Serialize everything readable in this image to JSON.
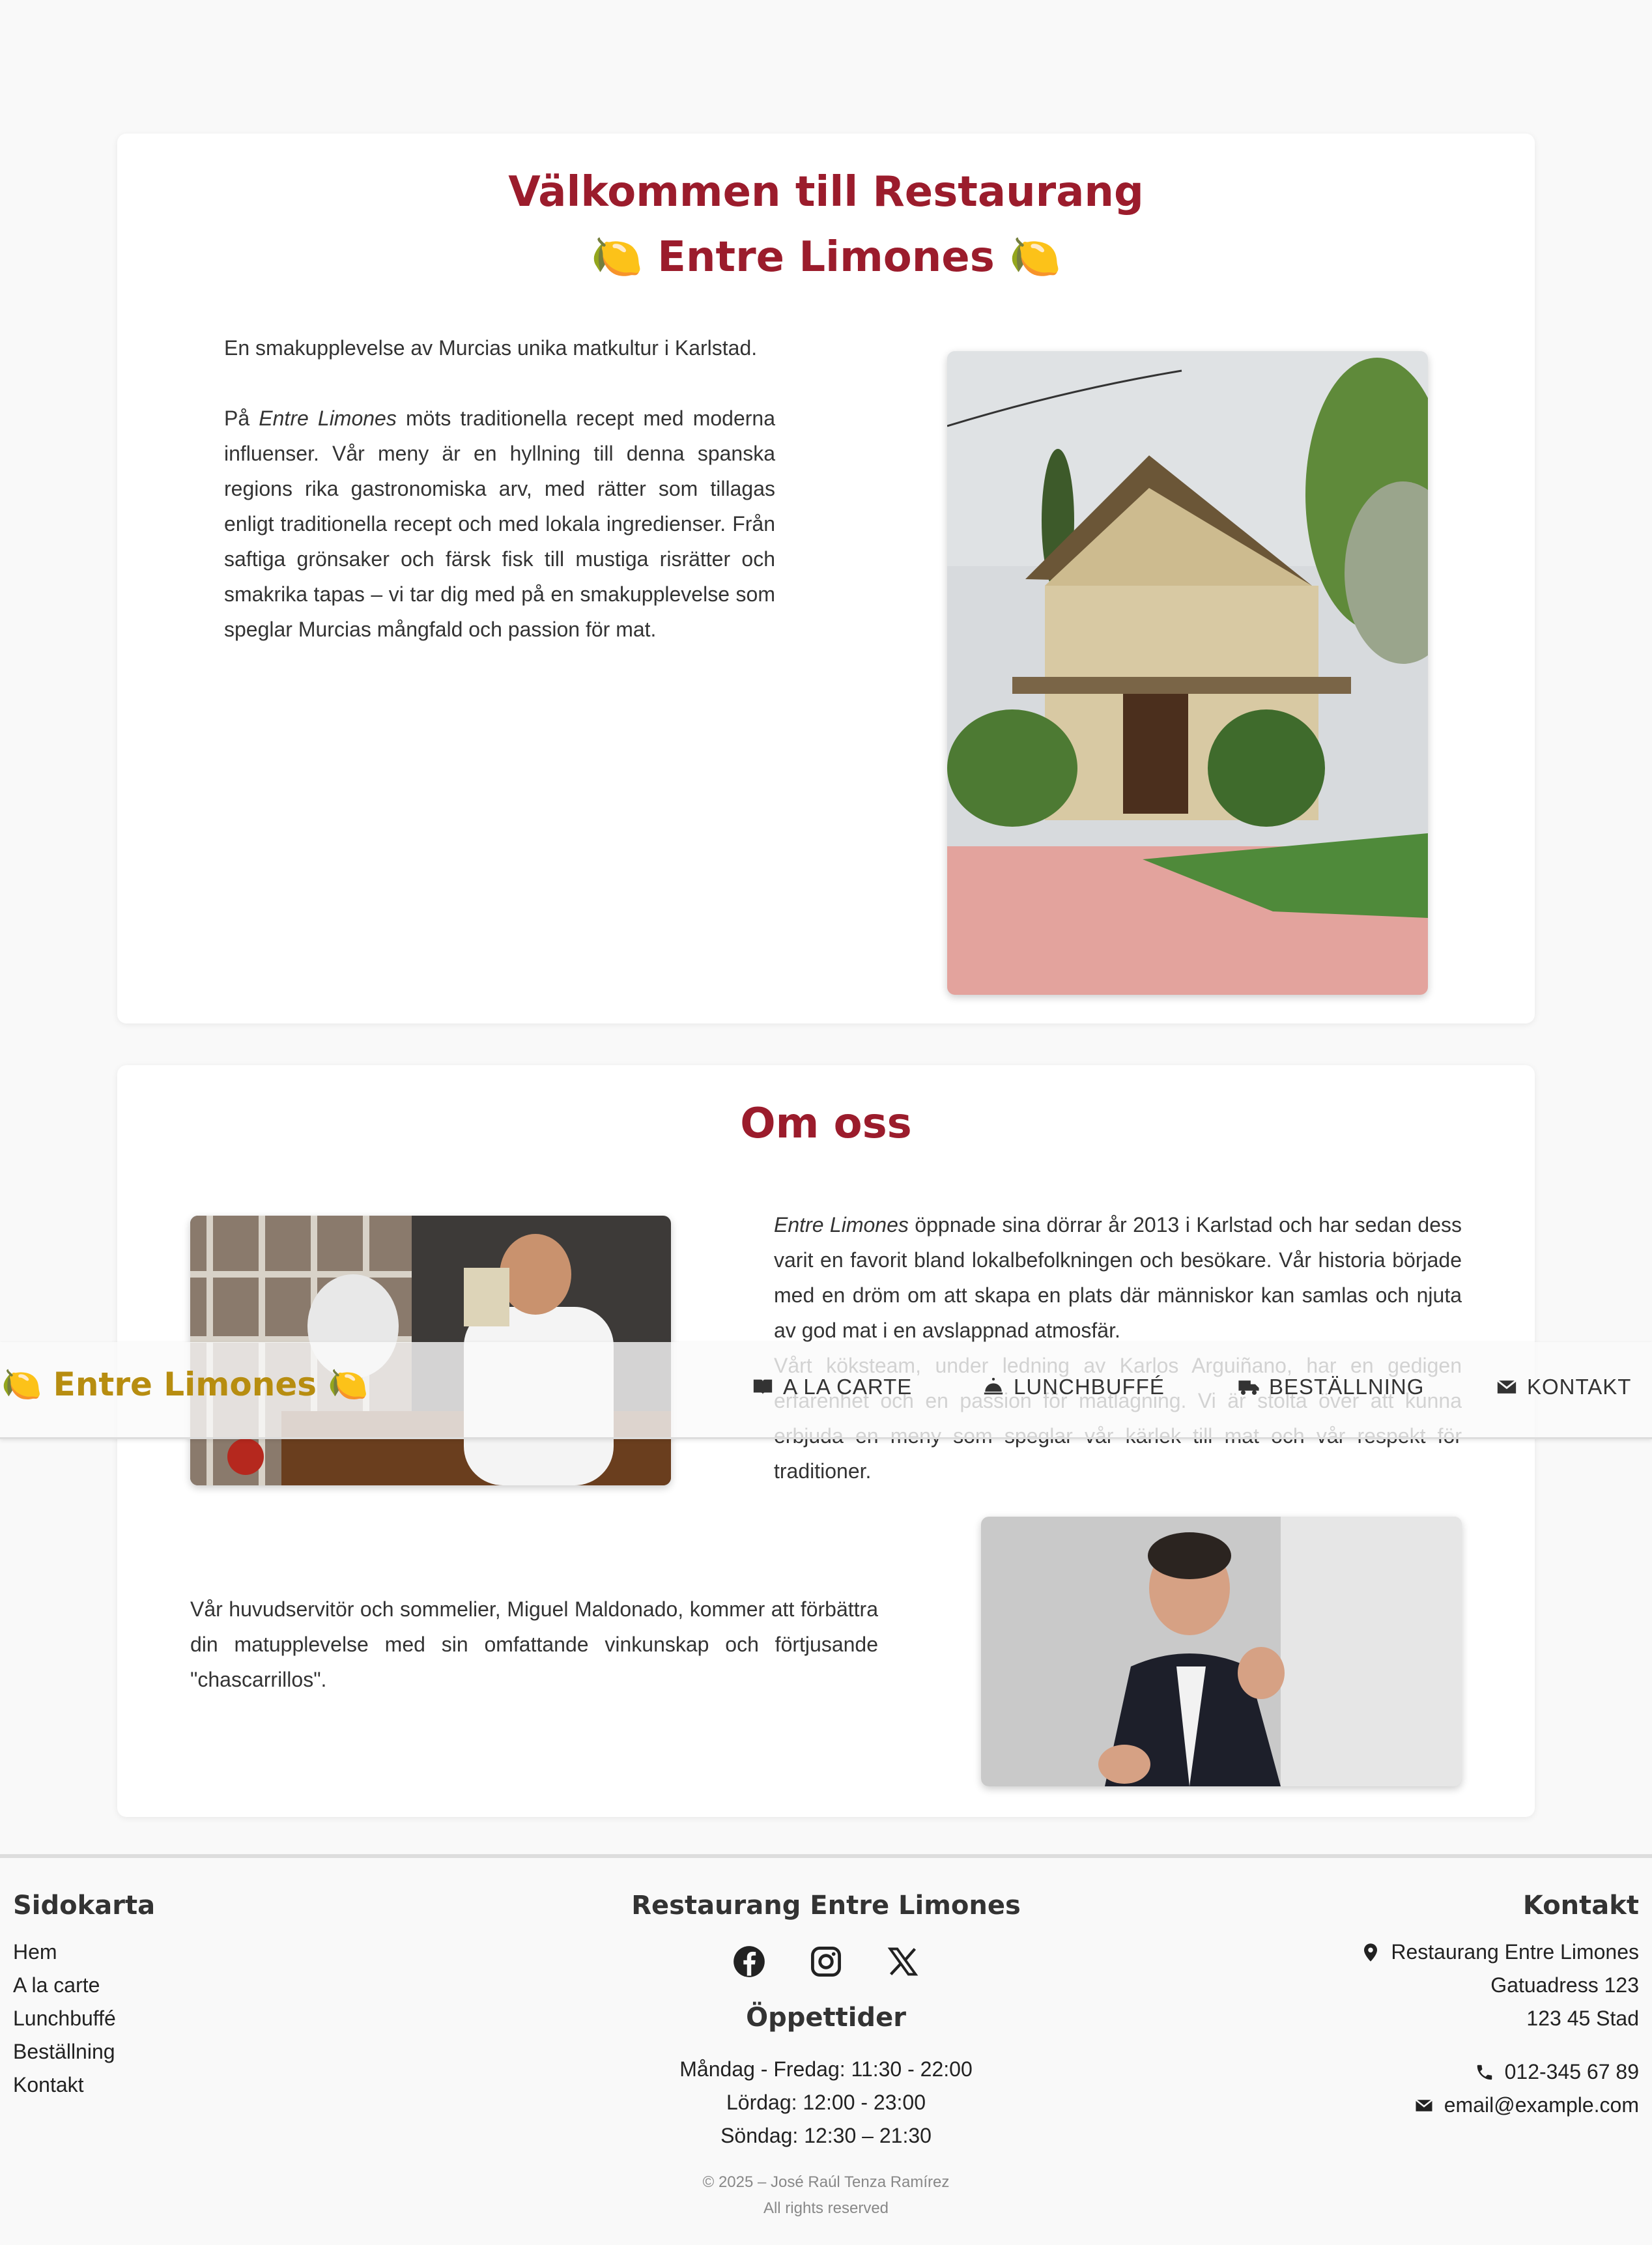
{
  "welcome": {
    "title_line1": "Välkommen till Restaurang",
    "title_line2": "🍋 Entre Limones 🍋",
    "intro": "En smakupplevelse av Murcias unika matkultur i Karlstad.",
    "body_prefix": "På ",
    "body_em": "Entre Limones",
    "body_rest": " möts traditionella recept med moderna influenser. Vår meny är en hyllning till denna spanska regions rika gastronomiska arv, med rätter som tillagas enligt traditionella recept och med lokala ingredienser. Från saftiga grönsaker och färsk fisk till mustiga risrätter och smakrika tapas – vi tar dig med på en smakupplevelse som speglar Murcias mångfald och passion för mat."
  },
  "about": {
    "title": "Om oss",
    "p1_em": "Entre Limones",
    "p1_rest": " öppnade sina dörrar år 2013 i Karlstad och har sedan dess varit en favorit bland lokalbefolkningen och besökare. Vår historia började med en dröm om att skapa en plats där människor kan samlas och njuta av god mat i en avslappnad atmosfär.",
    "p2": "Vårt köksteam, under ledning av Karlos Arguiñano, har en gedigen erfarenhet och en passion för matlagning. Vi är stolta över att kunna erbjuda en meny som speglar vår kärlek till mat och vår respekt för traditioner.",
    "p3": "Vår huvudservitör och sommelier, Miguel Maldonado, kommer att förbättra din matupplevelse med sin omfattande vinkunskap och förtjusande \"chascarrillos\"."
  },
  "nav": {
    "brand": "🍋 Entre Limones 🍋",
    "items": [
      {
        "label": "A LA CARTE",
        "icon": "book-icon"
      },
      {
        "label": "LUNCHBUFFÉ",
        "icon": "cloche-icon"
      },
      {
        "label": "BESTÄLLNING",
        "icon": "truck-icon"
      },
      {
        "label": "KONTAKT",
        "icon": "envelope-icon"
      }
    ]
  },
  "footer": {
    "sitemap_title": "Sidokarta",
    "sitemap": [
      "Hem",
      "A la carte",
      "Lunchbuffé",
      "Beställning",
      "Kontakt"
    ],
    "center_title": "Restaurang Entre Limones",
    "social": [
      "facebook-icon",
      "instagram-icon",
      "x-icon"
    ],
    "hours_title": "Öppettider",
    "hours": [
      "Måndag - Fredag: 11:30 - 22:00",
      "Lördag: 12:00 - 23:00",
      "Söndag: 12:30 – 21:30"
    ],
    "copyright": "© 2025 – José Raúl Tenza Ramírez",
    "rights": "All rights reserved",
    "contact_title": "Kontakt",
    "address": [
      "Restaurang Entre Limones",
      "Gatuadress 123",
      "123 45 Stad"
    ],
    "phone": "012-345 67 89",
    "email": "email@example.com"
  },
  "colors": {
    "accent": "#9b1c2c",
    "brand_gold": "#b78d10",
    "background": "#f9f9f9"
  }
}
